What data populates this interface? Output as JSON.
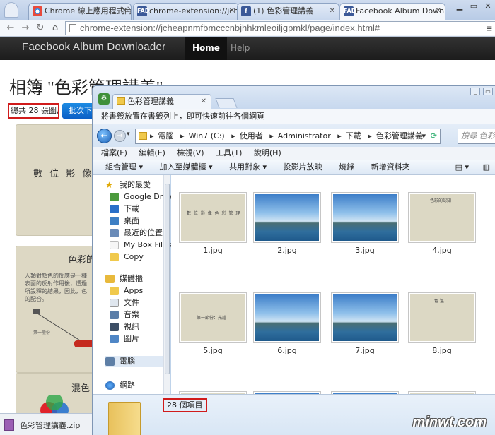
{
  "browser": {
    "tabs": [
      {
        "label": "Chrome 線上應用程式商店",
        "favicon": "chrome-icon"
      },
      {
        "label": "chrome-extension://jche",
        "favicon": "fad-icon"
      },
      {
        "label": "(1) 色彩管理講義",
        "favicon": "facebook-icon"
      },
      {
        "label": "Facebook Album Downl",
        "favicon": "fad-icon"
      }
    ],
    "fav_text": "FAD",
    "url": "chrome-extension://jcheapnmfbmcccnbjhhkmleoiljgpmkl/page/index.html#"
  },
  "app": {
    "brand": "Facebook Album Downloader",
    "nav": [
      "Home",
      "Help"
    ],
    "album_title": "相簿 \"色彩管理講義\"",
    "count_text": "總共 28 張圖片",
    "download_button": "批次下",
    "slides": [
      {
        "text": "數 位 影 像"
      },
      {
        "title": "色彩的",
        "body": "人類對顏色的反應是一種\n表面的反射作用後，透過\n所設釋的結果，因此，色\n的配合。",
        "caption": "第一般份"
      },
      {
        "title": "混色"
      }
    ]
  },
  "download_shelf": {
    "filename": "色彩管理講義.zip"
  },
  "explorer": {
    "tab_title": "色彩管理講義",
    "bookmarks_hint": "將書籤放置在書籤列上，即可快速前往各個網頁",
    "breadcrumb": [
      "電腦",
      "Win7 (C:)",
      "使用者",
      "Administrator",
      "下載",
      "色彩管理講義"
    ],
    "search_placeholder": "搜尋 色彩",
    "menu": [
      "檔案(F)",
      "編輯(E)",
      "檢視(V)",
      "工具(T)",
      "說明(H)"
    ],
    "commands": [
      "組合管理 ▾",
      "加入至媒體櫃 ▾",
      "共用對象 ▾",
      "投影片放映",
      "燒錄",
      "新增資料夾"
    ],
    "sidebar": {
      "favorites_label": "我的最愛",
      "favorites": [
        "Google Drive",
        "下載",
        "桌面",
        "最近的位置",
        "My Box Files",
        "Copy"
      ],
      "libraries_label": "媒體櫃",
      "libraries": [
        "Apps",
        "文件",
        "音樂",
        "視訊",
        "圖片"
      ],
      "computer": "電腦",
      "network": "網路"
    },
    "files": [
      {
        "name": "1.jpg",
        "kind": "beige",
        "caption": "數 位 影 像 色 彩 管 理"
      },
      {
        "name": "2.jpg",
        "kind": "sky"
      },
      {
        "name": "3.jpg",
        "kind": "sky"
      },
      {
        "name": "4.jpg",
        "kind": "beige",
        "caption": "色彩的認知"
      },
      {
        "name": "5.jpg",
        "kind": "beige",
        "caption": "第一節份：光譜"
      },
      {
        "name": "6.jpg",
        "kind": "sky"
      },
      {
        "name": "7.jpg",
        "kind": "sky"
      },
      {
        "name": "8.jpg",
        "kind": "beige",
        "caption": "色 溫"
      }
    ],
    "item_count": "28 個項目"
  },
  "watermark": "minwt.com",
  "colors": {
    "highlight_red": "#d01b1b",
    "button_blue": "#0b5fc6",
    "navbar": "#222222"
  }
}
